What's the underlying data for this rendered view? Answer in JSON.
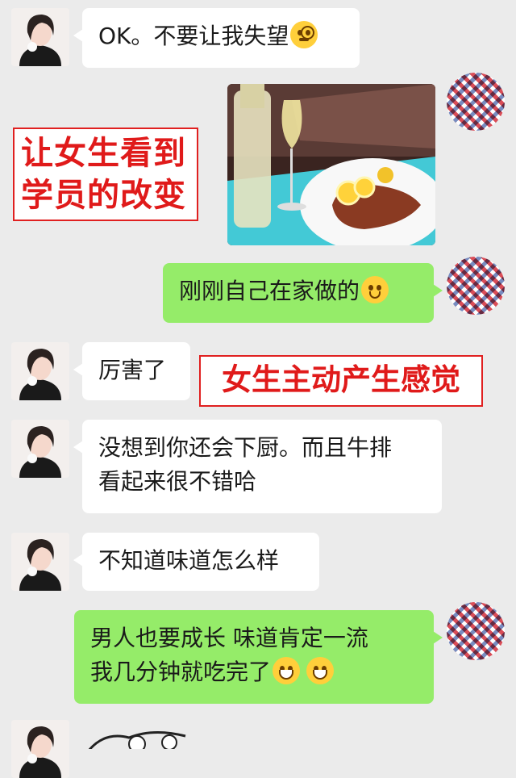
{
  "messages": [
    {
      "side": "left",
      "text": "OK。不要让我失望",
      "emoji": "monocle-face"
    },
    {
      "side": "right",
      "type": "image",
      "image_desc": "steak-and-wine-photo"
    },
    {
      "side": "right",
      "text": "刚刚自己在家做的",
      "emoji": "smiling-face"
    },
    {
      "side": "left",
      "text": "厉害了"
    },
    {
      "side": "left",
      "lines": [
        "没想到你还会下厨。而且牛排",
        "看起来很不错哈"
      ]
    },
    {
      "side": "left",
      "text": "不知道味道怎么样"
    },
    {
      "side": "right",
      "lines": [
        "男人也要成长  味道肯定一流",
        "我几分钟就吃完了"
      ],
      "emoji": "grinning-face"
    }
  ],
  "annotations": {
    "left_label_line1": "让女生看到",
    "left_label_line2": "学员的改变",
    "right_label": "女生主动产生感觉"
  },
  "colors": {
    "background": "#ebebeb",
    "bubble_incoming": "#ffffff",
    "bubble_outgoing": "#95ec69",
    "annotation_red": "#e01a1a"
  }
}
